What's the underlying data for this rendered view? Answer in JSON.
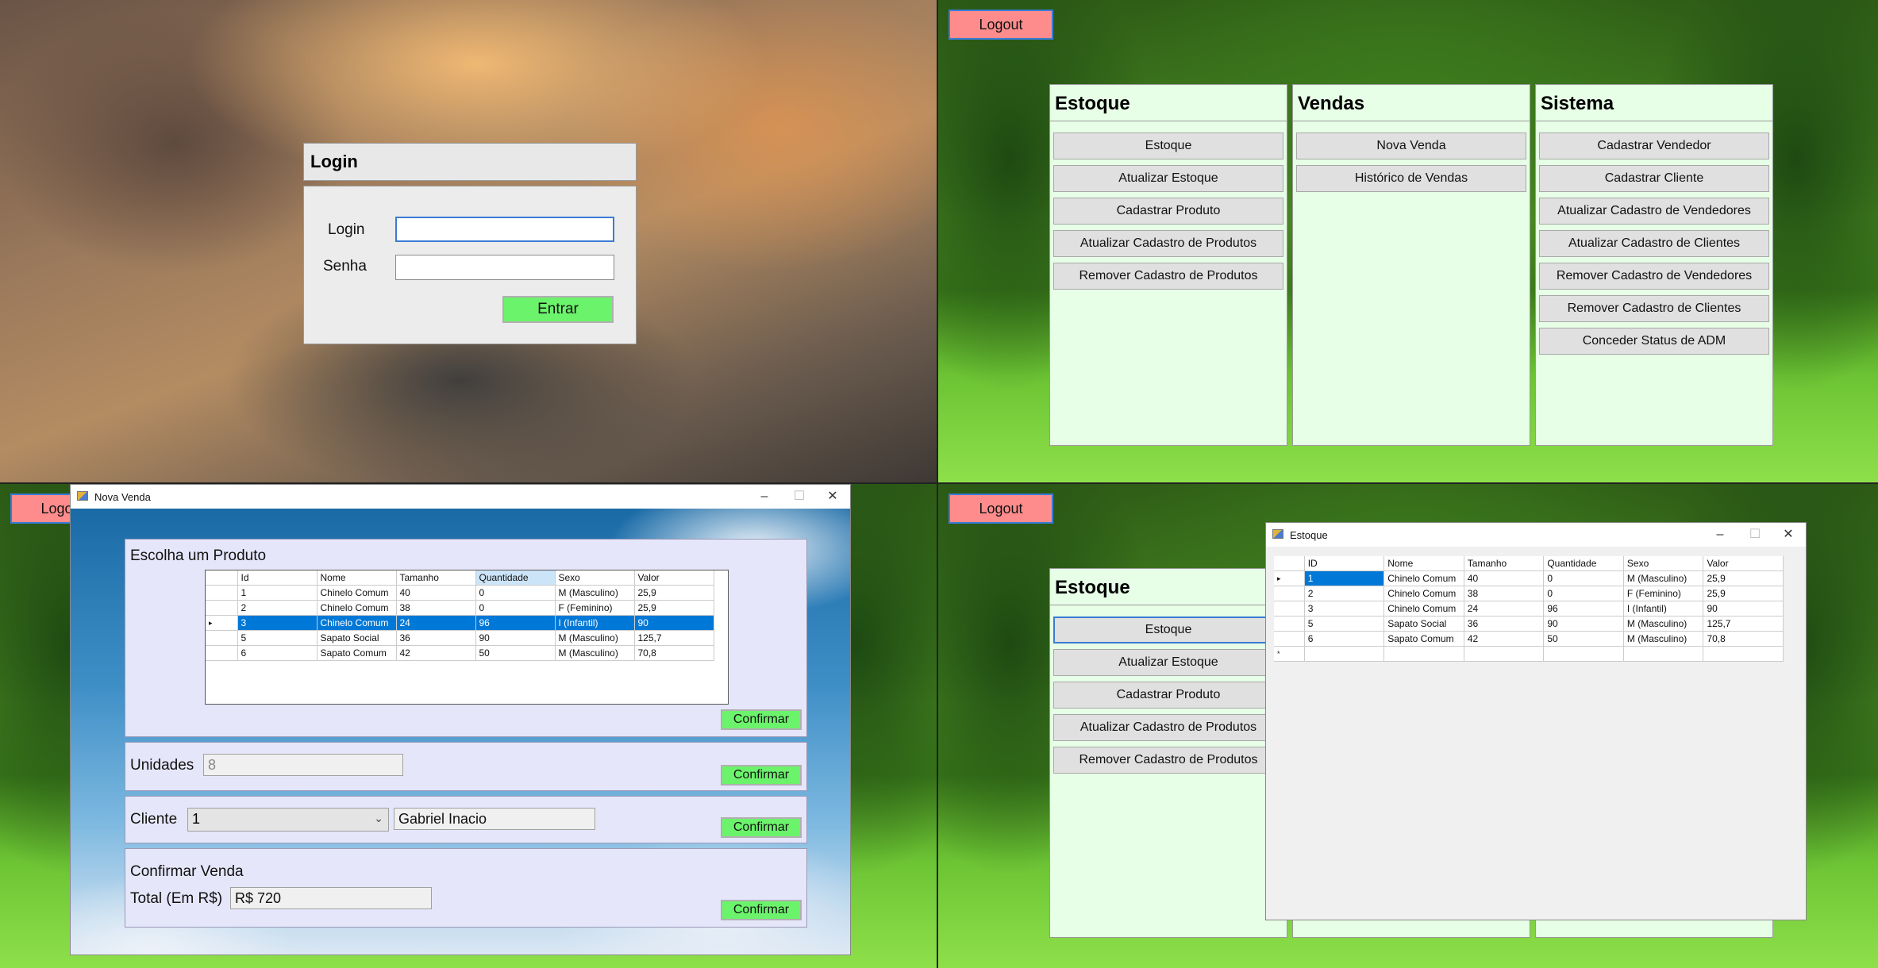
{
  "login_screen": {
    "header": "Login",
    "login_label": "Login",
    "password_label": "Senha",
    "login_value": "",
    "password_value": "",
    "submit_label": "Entrar"
  },
  "menu_screen": {
    "logout_label": "Logout",
    "estoque": {
      "title": "Estoque",
      "buttons": [
        "Estoque",
        "Atualizar Estoque",
        "Cadastrar Produto",
        "Atualizar Cadastro de Produtos",
        "Remover Cadastro de Produtos"
      ]
    },
    "vendas": {
      "title": "Vendas",
      "buttons": [
        "Nova Venda",
        "Histórico de Vendas"
      ]
    },
    "sistema": {
      "title": "Sistema",
      "buttons": [
        "Cadastrar Vendedor",
        "Cadastrar Cliente",
        "Atualizar Cadastro de Vendedores",
        "Atualizar Cadastro de Clientes",
        "Remover Cadastro de Vendedores",
        "Remover Cadastro de Clientes",
        "Conceder Status de ADM"
      ]
    }
  },
  "sale_window": {
    "behind_logout_label": "Logout",
    "title": "Nova Venda",
    "choose_product_label": "Escolha um Produto",
    "columns": [
      "Id",
      "Nome",
      "Tamanho",
      "Quantidade",
      "Sexo",
      "Valor"
    ],
    "rows": [
      [
        "1",
        "Chinelo Comum",
        "40",
        "0",
        "M (Masculino)",
        "25,9"
      ],
      [
        "2",
        "Chinelo Comum",
        "38",
        "0",
        "F (Feminino)",
        "25,9"
      ],
      [
        "3",
        "Chinelo Comum",
        "24",
        "96",
        "I (Infantil)",
        "90"
      ],
      [
        "5",
        "Sapato Social",
        "36",
        "90",
        "M (Masculino)",
        "125,7"
      ],
      [
        "6",
        "Sapato Comum",
        "42",
        "50",
        "M (Masculino)",
        "70,8"
      ]
    ],
    "confirm_label": "Confirmar",
    "units_label": "Unidades",
    "units_value": "8",
    "client_label": "Cliente",
    "client_id": "1",
    "client_name": "Gabriel Inacio",
    "confirm_sale_label": "Confirmar Venda",
    "total_label": "Total (Em R$)",
    "total_value": "R$ 720"
  },
  "stock_screen": {
    "logout_label": "Logout",
    "panel_title": "Estoque",
    "buttons": [
      "Estoque",
      "Atualizar Estoque",
      "Cadastrar Produto",
      "Atualizar Cadastro de Produtos",
      "Remover Cadastro de Produtos"
    ],
    "window_title": "Estoque",
    "columns": [
      "ID",
      "Nome",
      "Tamanho",
      "Quantidade",
      "Sexo",
      "Valor"
    ],
    "rows": [
      [
        "1",
        "Chinelo Comum",
        "40",
        "0",
        "M (Masculino)",
        "25,9"
      ],
      [
        "2",
        "Chinelo Comum",
        "38",
        "0",
        "F (Feminino)",
        "25,9"
      ],
      [
        "3",
        "Chinelo Comum",
        "24",
        "96",
        "I (Infantil)",
        "90"
      ],
      [
        "5",
        "Sapato Social",
        "36",
        "90",
        "M (Masculino)",
        "125,7"
      ],
      [
        "6",
        "Sapato Comum",
        "42",
        "50",
        "M (Masculino)",
        "70,8"
      ]
    ],
    "new_row_marker": "*"
  },
  "icons": {
    "row_pointer": "▸",
    "minimize": "–",
    "maximize": "☐",
    "close": "✕",
    "chevron": "⌄"
  },
  "colors": {
    "logout": "#ff8c8c",
    "confirm": "#6bf36b",
    "menu_panel": "#e6ffe6",
    "sale_section": "#e6e6fa",
    "selection": "#0078d7"
  }
}
